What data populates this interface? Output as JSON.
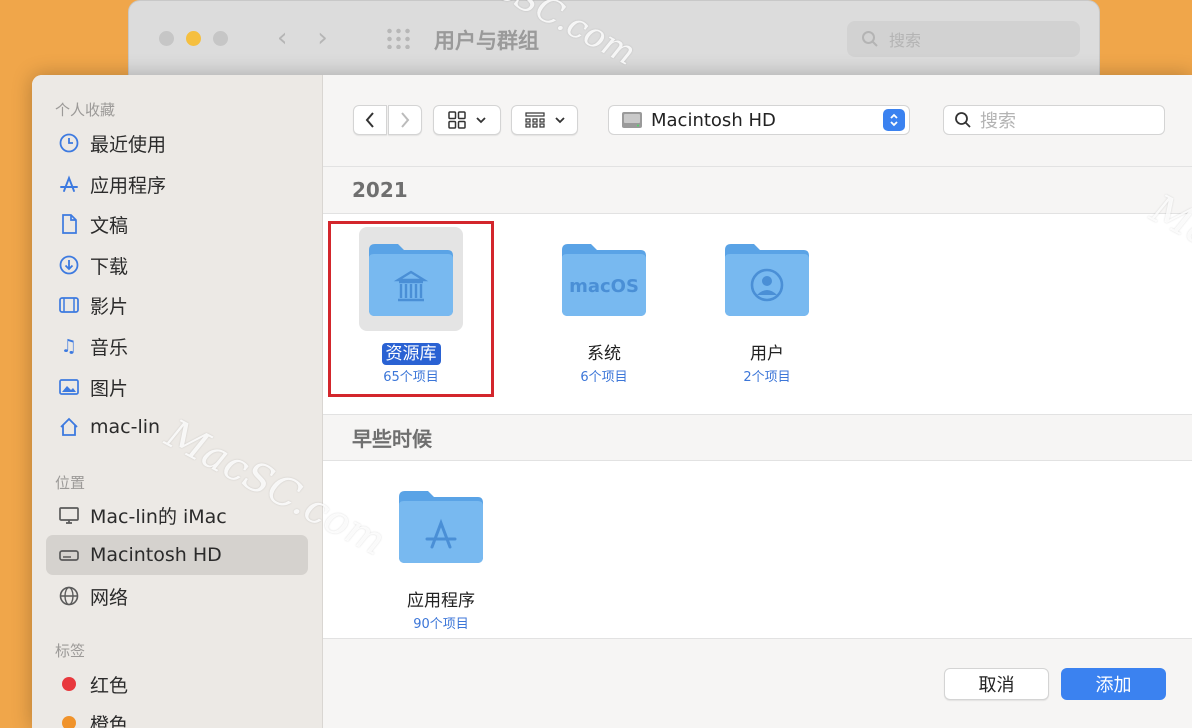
{
  "background_window": {
    "title": "用户与群组",
    "search_placeholder": "搜索"
  },
  "sidebar": {
    "sections": [
      {
        "title": "个人收藏",
        "items": [
          {
            "label": "最近使用",
            "icon": "clock-icon"
          },
          {
            "label": "应用程序",
            "icon": "app-store-icon"
          },
          {
            "label": "文稿",
            "icon": "document-icon"
          },
          {
            "label": "下载",
            "icon": "download-icon"
          },
          {
            "label": "影片",
            "icon": "film-icon"
          },
          {
            "label": "音乐",
            "icon": "music-note-icon"
          },
          {
            "label": "图片",
            "icon": "photo-icon"
          },
          {
            "label": "mac-lin",
            "icon": "home-icon"
          }
        ]
      },
      {
        "title": "位置",
        "items": [
          {
            "label": "Mac-lin的 iMac",
            "icon": "monitor-icon"
          },
          {
            "label": "Macintosh HD",
            "icon": "disk-icon",
            "selected": true
          },
          {
            "label": "网络",
            "icon": "globe-icon"
          }
        ]
      },
      {
        "title": "标签",
        "items": [
          {
            "label": "红色",
            "color": "#e8383d"
          },
          {
            "label": "橙色",
            "color": "#f0932b"
          }
        ]
      }
    ]
  },
  "toolbar": {
    "location": "Macintosh HD",
    "search_placeholder": "搜索"
  },
  "groups": [
    {
      "title": "2021",
      "items": [
        {
          "name": "资源库",
          "count": "65个项目",
          "icon": "library-folder-icon",
          "selected": true
        },
        {
          "name": "系统",
          "count": "6个项目",
          "icon": "macos-folder-icon",
          "folder_label": "macOS"
        },
        {
          "name": "用户",
          "count": "2个项目",
          "icon": "users-folder-icon"
        }
      ]
    },
    {
      "title": "早些时候",
      "items": [
        {
          "name": "应用程序",
          "count": "90个项目",
          "icon": "applications-folder-icon"
        }
      ]
    }
  ],
  "buttons": {
    "cancel": "取消",
    "add": "添加"
  },
  "watermarks": [
    "MacSC.com",
    "MacSC.com",
    "MacSC.com"
  ],
  "colors": {
    "accent": "#3b82f0",
    "selection": "#2a62d3",
    "highlight_box": "#d3262c",
    "folder": "#6fb3ec"
  }
}
